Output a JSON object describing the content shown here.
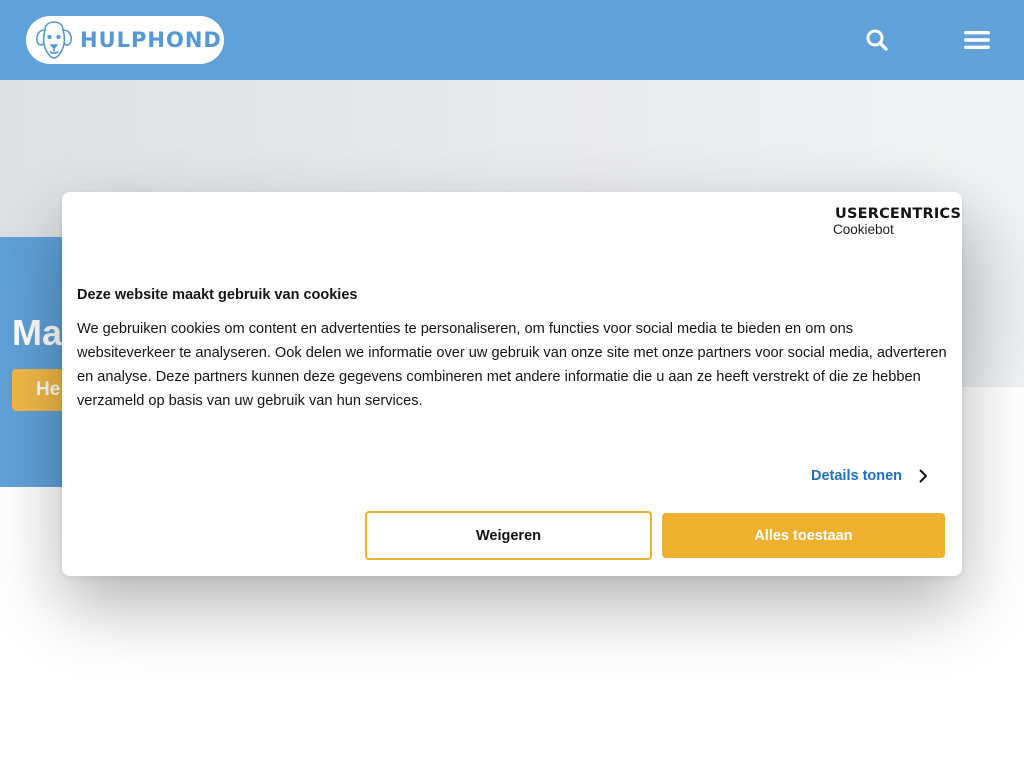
{
  "header": {
    "logo_text": "HULPHOND",
    "colors": {
      "header_bg": "#4a94d4",
      "accent": "#f0b02f"
    },
    "icons": {
      "search": "search-icon",
      "menu": "hamburger-menu-icon",
      "logo": "dog-face-icon"
    }
  },
  "hero": {
    "heading_visible": "Ma",
    "button_visible": "He"
  },
  "cookie_dialog": {
    "brand_name": "USERCENTRICS",
    "brand_sub": "Cookiebot",
    "title": "Deze website maakt gebruik van cookies",
    "body": "We gebruiken cookies om content en advertenties te personaliseren, om functies voor social media te bieden en om ons websiteverkeer te analyseren. Ook delen we informatie over uw gebruik van onze site met onze partners voor social media, adverteren en analyse. Deze partners kunnen deze gegevens combineren met andere informatie die u aan ze heeft verstrekt of die ze hebben verzameld op basis van uw gebruik van hun services.",
    "details_label": "Details tonen",
    "decline_label": "Weigeren",
    "allow_label": "Alles toestaan"
  }
}
